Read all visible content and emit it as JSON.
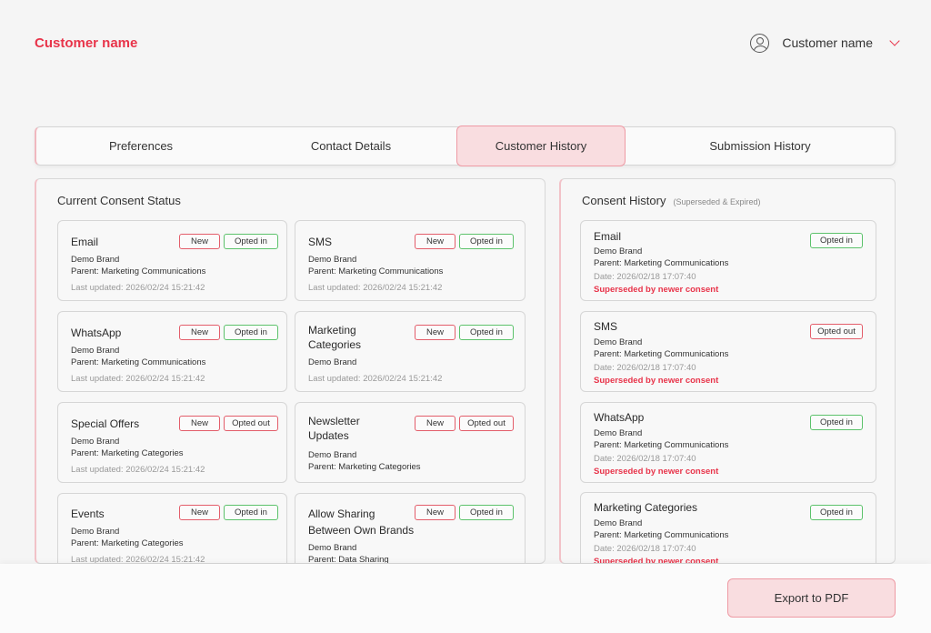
{
  "header": {
    "brand": "Customer name",
    "user_name": "Customer name"
  },
  "tabs": [
    {
      "label": "Preferences",
      "active": false
    },
    {
      "label": "Contact Details",
      "active": false
    },
    {
      "label": "Customer History",
      "active": true
    },
    {
      "label": "Submission History",
      "active": false
    }
  ],
  "current": {
    "title": "Current Consent Status",
    "cards": [
      {
        "title": "Email",
        "brand": "Demo Brand",
        "parent": "Parent: Marketing Communications",
        "updated": "Last updated: 2026/02/24 15:21:42",
        "badge_new": "New",
        "status": "Opted in",
        "status_color": "#5cc26b"
      },
      {
        "title": "SMS",
        "brand": "Demo Brand",
        "parent": "Parent: Marketing Communications",
        "updated": "Last updated: 2026/02/24 15:21:42",
        "badge_new": "New",
        "status": "Opted in",
        "status_color": "#5cc26b"
      },
      {
        "title": "WhatsApp",
        "brand": "Demo Brand",
        "parent": "Parent: Marketing Communications",
        "updated": "Last updated: 2026/02/24 15:21:42",
        "badge_new": "New",
        "status": "Opted in",
        "status_color": "#5cc26b"
      },
      {
        "title_1": "Marketing",
        "title_2": "Categories",
        "brand": "Demo Brand",
        "updated": "Last updated: 2026/02/24 15:21:42",
        "badge_new": "New",
        "status": "Opted in",
        "status_color": "#5cc26b"
      },
      {
        "title": "Special Offers",
        "brand": "Demo Brand",
        "parent": "Parent: Marketing Categories",
        "updated": "Last updated: 2026/02/24 15:21:42",
        "badge_new": "New",
        "status": "Opted out",
        "status_color": "#e35d6a"
      },
      {
        "title_1": "Newsletter",
        "title_2": "Updates",
        "brand": "Demo Brand",
        "parent": "Parent: Marketing Categories",
        "badge_new": "New",
        "status": "Opted out",
        "status_color": "#e35d6a"
      },
      {
        "title": "Events",
        "brand": "Demo Brand",
        "parent": "Parent: Marketing Categories",
        "updated": "Last updated: 2026/02/24 15:21:42",
        "badge_new": "New",
        "status": "Opted in",
        "status_color": "#5cc26b"
      },
      {
        "title_1": "Allow Sharing",
        "title_2": "Between Own Brands",
        "brand": "Demo Brand",
        "parent": "Parent: Data Sharing",
        "badge_new": "New",
        "status": "Opted in",
        "status_color": "#5cc26b"
      }
    ]
  },
  "history": {
    "title": "Consent History",
    "subtitle": "(Superseded & Expired)",
    "cards": [
      {
        "title": "Email",
        "brand": "Demo Brand",
        "parent": "Parent: Marketing Communications",
        "date": "Date: 2026/02/18 17:07:40",
        "note": "Superseded by newer consent",
        "status": "Opted in",
        "status_color": "#5cc26b"
      },
      {
        "title": "SMS",
        "brand": "Demo Brand",
        "parent": "Parent: Marketing Communications",
        "date": "Date: 2026/02/18 17:07:40",
        "note": "Superseded by newer consent",
        "status": "Opted out",
        "status_color": "#e35d6a"
      },
      {
        "title": "WhatsApp",
        "brand": "Demo Brand",
        "parent": "Parent: Marketing Communications",
        "date": "Date: 2026/02/18 17:07:40",
        "note": "Superseded by newer consent",
        "status": "Opted in",
        "status_color": "#5cc26b"
      },
      {
        "title": "Marketing Categories",
        "brand": "Demo Brand",
        "parent": "Parent: Marketing Communications",
        "date": "Date: 2026/02/18 17:07:40",
        "note": "Superseded by newer consent",
        "status": "Opted in",
        "status_color": "#5cc26b"
      }
    ]
  },
  "footer": {
    "export_label": "Export to PDF"
  }
}
